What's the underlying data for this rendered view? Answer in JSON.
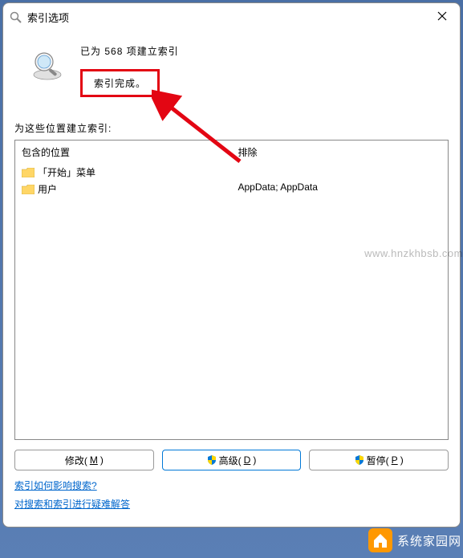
{
  "window": {
    "title": "索引选项"
  },
  "status": {
    "line1_prefix": "已为 ",
    "count": "568",
    "line1_suffix": " 项建立索引",
    "complete": "索引完成。"
  },
  "section_label": "为这些位置建立索引:",
  "columns": {
    "included": "包含的位置",
    "excluded": "排除"
  },
  "items": [
    {
      "name": "「开始」菜单",
      "excluded": ""
    },
    {
      "name": "用户",
      "excluded": "AppData; AppData"
    }
  ],
  "buttons": {
    "modify": "修改(",
    "modify_key": "M",
    "modify_suffix": ")",
    "advanced": "高级(",
    "advanced_key": "D",
    "advanced_suffix": ")",
    "pause": "暂停(",
    "pause_key": "P",
    "pause_suffix": ")"
  },
  "links": {
    "a": "索引如何影响搜索?",
    "b": "对搜索和索引进行疑难解答"
  },
  "watermark": "www.hnzkhbsb.com",
  "footer": "系统家园网"
}
